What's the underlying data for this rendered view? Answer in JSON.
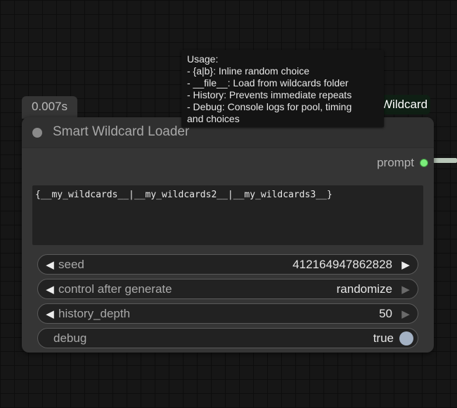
{
  "node": {
    "exec_time": "0.007s",
    "title": "Smart Wildcard Loader",
    "output_label": "prompt",
    "prompt_text": "{__my_wildcards__|__my_wildcards2__|__my_wildcards3__}"
  },
  "side_tag": "Wildcard",
  "tooltip": {
    "lines": [
      "Usage:",
      "- {a|b}: Inline random choice",
      "- __file__: Load from wildcards folder",
      "- History: Prevents immediate repeats",
      "- Debug: Console logs for pool, timing",
      "and choices"
    ]
  },
  "widgets": [
    {
      "label": "seed",
      "value": "412164947862828",
      "type": "number"
    },
    {
      "label": "control after generate",
      "value": "randomize",
      "type": "combo"
    },
    {
      "label": "history_depth",
      "value": "50",
      "type": "number"
    },
    {
      "label": "debug",
      "value": "true",
      "type": "toggle"
    }
  ],
  "colors": {
    "output_slot": "#7bee7b",
    "canvas_bg": "#161616",
    "node_bg": "#353535"
  }
}
